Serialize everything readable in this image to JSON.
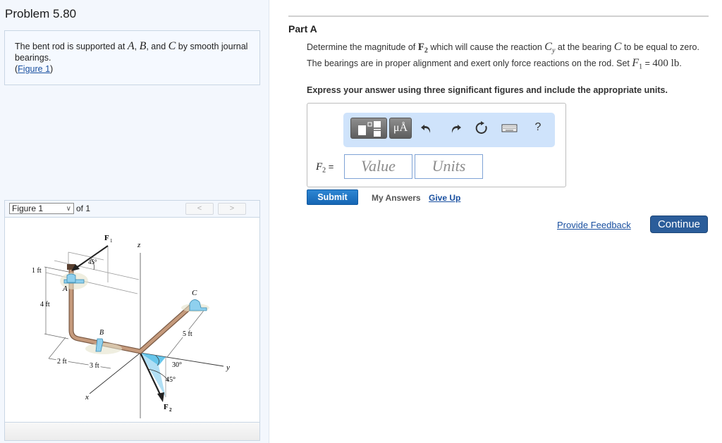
{
  "problem": {
    "title": "Problem 5.80",
    "statement_pre": "The bent rod is supported at ",
    "var_a": "A",
    "sep1": ", ",
    "var_b": "B",
    "sep2": ", and ",
    "var_c": "C",
    "statement_post": " by smooth journal bearings.",
    "figure_link_open": "(",
    "figure_link": "Figure 1",
    "figure_link_close": ")"
  },
  "figure_panel": {
    "select_value": "Figure 1",
    "of_label": "of 1",
    "prev_label": "<",
    "next_label": ">",
    "labels": {
      "f1": "F",
      "f1_sub": "1",
      "f2": "F",
      "f2_sub": "2",
      "z": "z",
      "y": "y",
      "x": "x",
      "a": "A",
      "b": "B",
      "c": "C",
      "angle_45_top": "45°",
      "dim_1ft": "1 ft",
      "dim_4ft": "4 ft",
      "dim_2ft": "2 ft",
      "dim_3ft": "3 ft",
      "dim_5ft": "5 ft",
      "angle_30": "30°",
      "angle_45_bottom": "45°"
    }
  },
  "part": {
    "title": "Part A",
    "q1": "Determine the magnitude of ",
    "q_f2": "F",
    "q_f2_sub": "2",
    "q2": " which will cause the reaction ",
    "q_cy": "C",
    "q_cy_sub": "y",
    "q3": " at the bearing ",
    "q_c": "C",
    "q4": " to be equal to zero. The bearings are in proper alignment and exert only force reactions on the rod. Set ",
    "q_f1": "F",
    "q_f1_sub": "1",
    "q5": " = ",
    "q_val": "400 lb",
    "q6": ".",
    "instruction": "Express your answer using three significant figures and include the appropriate units."
  },
  "answer": {
    "toolbar": {
      "templates_icon": "templates-icon",
      "units_label": "μÅ",
      "undo_glyph": "↰",
      "redo_glyph": "↱",
      "reset_glyph": "↻",
      "keyboard_icon": "keyboard-icon",
      "help_label": "?"
    },
    "var_label": "F",
    "var_sub": "2",
    "var_eq": " =",
    "value_placeholder": "Value",
    "units_placeholder": "Units",
    "value": "",
    "units": ""
  },
  "actions": {
    "submit": "Submit",
    "my_answers": "My Answers",
    "give_up": "Give Up",
    "provide_feedback": "Provide Feedback",
    "continue": "Continue"
  },
  "colors": {
    "accent_blue": "#1666b4",
    "continue_blue": "#2b5d9a",
    "link_blue": "#1a50a0",
    "toolbar_bg": "#cfe3fb",
    "rod": "#b88a6c",
    "bearing": "#8fd0ee"
  }
}
